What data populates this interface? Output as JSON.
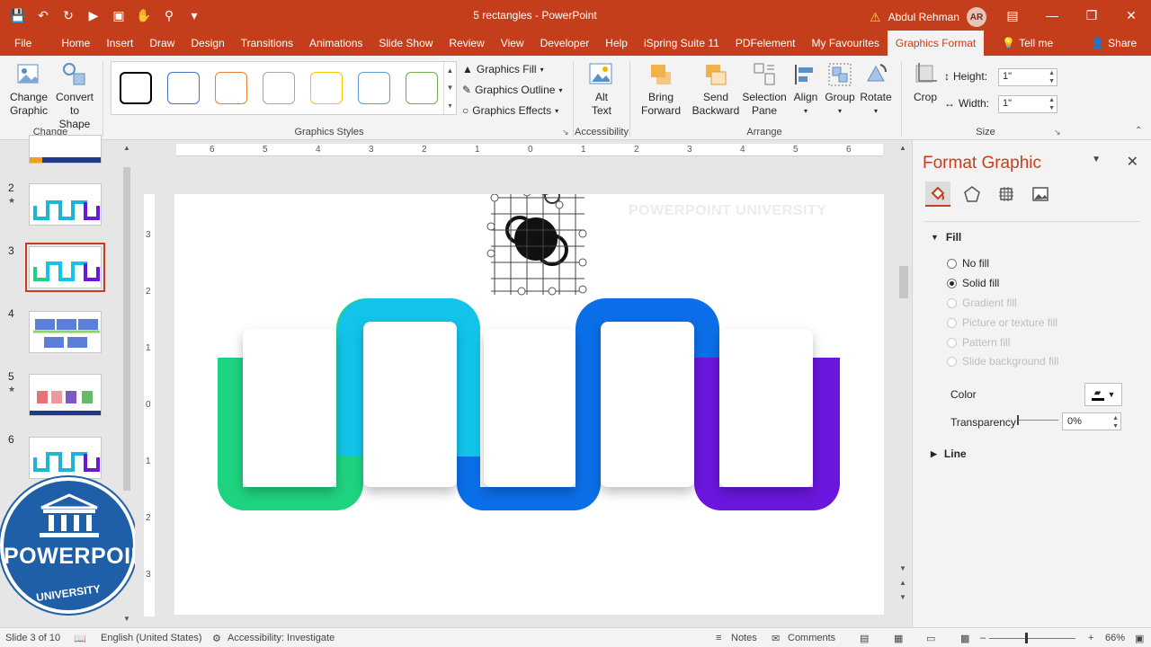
{
  "window": {
    "title": "5 rectangles  -  PowerPoint",
    "user_name": "Abdul Rehman",
    "user_initials": "AR"
  },
  "tabs": [
    {
      "label": "File"
    },
    {
      "label": "Home"
    },
    {
      "label": "Insert"
    },
    {
      "label": "Draw"
    },
    {
      "label": "Design"
    },
    {
      "label": "Transitions"
    },
    {
      "label": "Animations"
    },
    {
      "label": "Slide Show"
    },
    {
      "label": "Review"
    },
    {
      "label": "View"
    },
    {
      "label": "Developer"
    },
    {
      "label": "Help"
    },
    {
      "label": "iSpring Suite 11"
    },
    {
      "label": "PDFelement"
    },
    {
      "label": "My Favourites"
    },
    {
      "label": "Graphics Format"
    }
  ],
  "tell_me": "Tell me",
  "share": "Share",
  "ribbon": {
    "change_graphic": "Change\nGraphic",
    "convert_to_shape": "Convert\nto Shape",
    "group_change": "Change",
    "graphics_fill": "Graphics Fill",
    "graphics_outline": "Graphics Outline",
    "graphics_effects": "Graphics Effects",
    "group_styles": "Graphics Styles",
    "alt_text": "Alt\nText",
    "group_accessibility": "Accessibility",
    "bring_forward": "Bring\nForward",
    "send_backward": "Send\nBackward",
    "selection_pane": "Selection\nPane",
    "align": "Align",
    "group_btn": "Group",
    "rotate": "Rotate",
    "group_arrange": "Arrange",
    "crop": "Crop",
    "height_label": "Height:",
    "height_value": "1\"",
    "width_label": "Width:",
    "width_value": "1\"",
    "group_size": "Size",
    "style_colors": [
      "#000000",
      "#4472c4",
      "#ed7d31",
      "#a5a5a5",
      "#ffc000",
      "#5b9bd5",
      "#70ad47"
    ]
  },
  "thumbnails": [
    {
      "num": "2",
      "star": "★"
    },
    {
      "num": "3",
      "star": ""
    },
    {
      "num": "4",
      "star": ""
    },
    {
      "num": "5",
      "star": "★"
    },
    {
      "num": "6",
      "star": ""
    }
  ],
  "logo": {
    "word1": "POWERPOINT",
    "word2": "UNIVERSITY"
  },
  "slide": {
    "watermark": "POWERPOINT UNIVERSITY"
  },
  "ruler": {
    "h_ticks": [
      "6",
      "5",
      "4",
      "3",
      "2",
      "1",
      "0",
      "1",
      "2",
      "3",
      "4",
      "5",
      "6"
    ],
    "v_ticks": [
      "3",
      "2",
      "1",
      "0",
      "1",
      "2",
      "3"
    ]
  },
  "pane": {
    "title": "Format Graphic",
    "fill_section": "Fill",
    "options": [
      {
        "label": "No fill",
        "enabled": true,
        "selected": false
      },
      {
        "label": "Solid fill",
        "enabled": true,
        "selected": true
      },
      {
        "label": "Gradient fill",
        "enabled": false,
        "selected": false
      },
      {
        "label": "Picture or texture fill",
        "enabled": false,
        "selected": false
      },
      {
        "label": "Pattern fill",
        "enabled": false,
        "selected": false
      },
      {
        "label": "Slide background fill",
        "enabled": false,
        "selected": false
      }
    ],
    "color_label": "Color",
    "transparency_label": "Transparency",
    "transparency_value": "0%",
    "line_section": "Line"
  },
  "status": {
    "slide": "Slide 3 of 10",
    "language": "English (United States)",
    "accessibility": "Accessibility: Investigate",
    "notes": "Notes",
    "comments": "Comments",
    "zoom": "66%"
  },
  "colors": {
    "accent": "#c43e1c",
    "green": "#1ed37f",
    "cyan": "#12c4ea",
    "blue": "#0a6ee8",
    "purple": "#6a16dc"
  }
}
